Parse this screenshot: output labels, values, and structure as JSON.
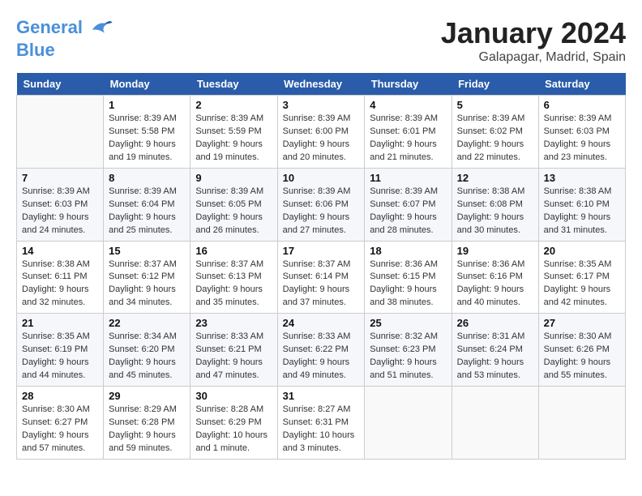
{
  "header": {
    "logo_line1": "General",
    "logo_line2": "Blue",
    "title": "January 2024",
    "subtitle": "Galapagar, Madrid, Spain"
  },
  "weekdays": [
    "Sunday",
    "Monday",
    "Tuesday",
    "Wednesday",
    "Thursday",
    "Friday",
    "Saturday"
  ],
  "weeks": [
    [
      {
        "day": "",
        "info": ""
      },
      {
        "day": "1",
        "info": "Sunrise: 8:39 AM\nSunset: 5:58 PM\nDaylight: 9 hours\nand 19 minutes."
      },
      {
        "day": "2",
        "info": "Sunrise: 8:39 AM\nSunset: 5:59 PM\nDaylight: 9 hours\nand 19 minutes."
      },
      {
        "day": "3",
        "info": "Sunrise: 8:39 AM\nSunset: 6:00 PM\nDaylight: 9 hours\nand 20 minutes."
      },
      {
        "day": "4",
        "info": "Sunrise: 8:39 AM\nSunset: 6:01 PM\nDaylight: 9 hours\nand 21 minutes."
      },
      {
        "day": "5",
        "info": "Sunrise: 8:39 AM\nSunset: 6:02 PM\nDaylight: 9 hours\nand 22 minutes."
      },
      {
        "day": "6",
        "info": "Sunrise: 8:39 AM\nSunset: 6:03 PM\nDaylight: 9 hours\nand 23 minutes."
      }
    ],
    [
      {
        "day": "7",
        "info": "Sunrise: 8:39 AM\nSunset: 6:03 PM\nDaylight: 9 hours\nand 24 minutes."
      },
      {
        "day": "8",
        "info": "Sunrise: 8:39 AM\nSunset: 6:04 PM\nDaylight: 9 hours\nand 25 minutes."
      },
      {
        "day": "9",
        "info": "Sunrise: 8:39 AM\nSunset: 6:05 PM\nDaylight: 9 hours\nand 26 minutes."
      },
      {
        "day": "10",
        "info": "Sunrise: 8:39 AM\nSunset: 6:06 PM\nDaylight: 9 hours\nand 27 minutes."
      },
      {
        "day": "11",
        "info": "Sunrise: 8:39 AM\nSunset: 6:07 PM\nDaylight: 9 hours\nand 28 minutes."
      },
      {
        "day": "12",
        "info": "Sunrise: 8:38 AM\nSunset: 6:08 PM\nDaylight: 9 hours\nand 30 minutes."
      },
      {
        "day": "13",
        "info": "Sunrise: 8:38 AM\nSunset: 6:10 PM\nDaylight: 9 hours\nand 31 minutes."
      }
    ],
    [
      {
        "day": "14",
        "info": "Sunrise: 8:38 AM\nSunset: 6:11 PM\nDaylight: 9 hours\nand 32 minutes."
      },
      {
        "day": "15",
        "info": "Sunrise: 8:37 AM\nSunset: 6:12 PM\nDaylight: 9 hours\nand 34 minutes."
      },
      {
        "day": "16",
        "info": "Sunrise: 8:37 AM\nSunset: 6:13 PM\nDaylight: 9 hours\nand 35 minutes."
      },
      {
        "day": "17",
        "info": "Sunrise: 8:37 AM\nSunset: 6:14 PM\nDaylight: 9 hours\nand 37 minutes."
      },
      {
        "day": "18",
        "info": "Sunrise: 8:36 AM\nSunset: 6:15 PM\nDaylight: 9 hours\nand 38 minutes."
      },
      {
        "day": "19",
        "info": "Sunrise: 8:36 AM\nSunset: 6:16 PM\nDaylight: 9 hours\nand 40 minutes."
      },
      {
        "day": "20",
        "info": "Sunrise: 8:35 AM\nSunset: 6:17 PM\nDaylight: 9 hours\nand 42 minutes."
      }
    ],
    [
      {
        "day": "21",
        "info": "Sunrise: 8:35 AM\nSunset: 6:19 PM\nDaylight: 9 hours\nand 44 minutes."
      },
      {
        "day": "22",
        "info": "Sunrise: 8:34 AM\nSunset: 6:20 PM\nDaylight: 9 hours\nand 45 minutes."
      },
      {
        "day": "23",
        "info": "Sunrise: 8:33 AM\nSunset: 6:21 PM\nDaylight: 9 hours\nand 47 minutes."
      },
      {
        "day": "24",
        "info": "Sunrise: 8:33 AM\nSunset: 6:22 PM\nDaylight: 9 hours\nand 49 minutes."
      },
      {
        "day": "25",
        "info": "Sunrise: 8:32 AM\nSunset: 6:23 PM\nDaylight: 9 hours\nand 51 minutes."
      },
      {
        "day": "26",
        "info": "Sunrise: 8:31 AM\nSunset: 6:24 PM\nDaylight: 9 hours\nand 53 minutes."
      },
      {
        "day": "27",
        "info": "Sunrise: 8:30 AM\nSunset: 6:26 PM\nDaylight: 9 hours\nand 55 minutes."
      }
    ],
    [
      {
        "day": "28",
        "info": "Sunrise: 8:30 AM\nSunset: 6:27 PM\nDaylight: 9 hours\nand 57 minutes."
      },
      {
        "day": "29",
        "info": "Sunrise: 8:29 AM\nSunset: 6:28 PM\nDaylight: 9 hours\nand 59 minutes."
      },
      {
        "day": "30",
        "info": "Sunrise: 8:28 AM\nSunset: 6:29 PM\nDaylight: 10 hours\nand 1 minute."
      },
      {
        "day": "31",
        "info": "Sunrise: 8:27 AM\nSunset: 6:31 PM\nDaylight: 10 hours\nand 3 minutes."
      },
      {
        "day": "",
        "info": ""
      },
      {
        "day": "",
        "info": ""
      },
      {
        "day": "",
        "info": ""
      }
    ]
  ]
}
